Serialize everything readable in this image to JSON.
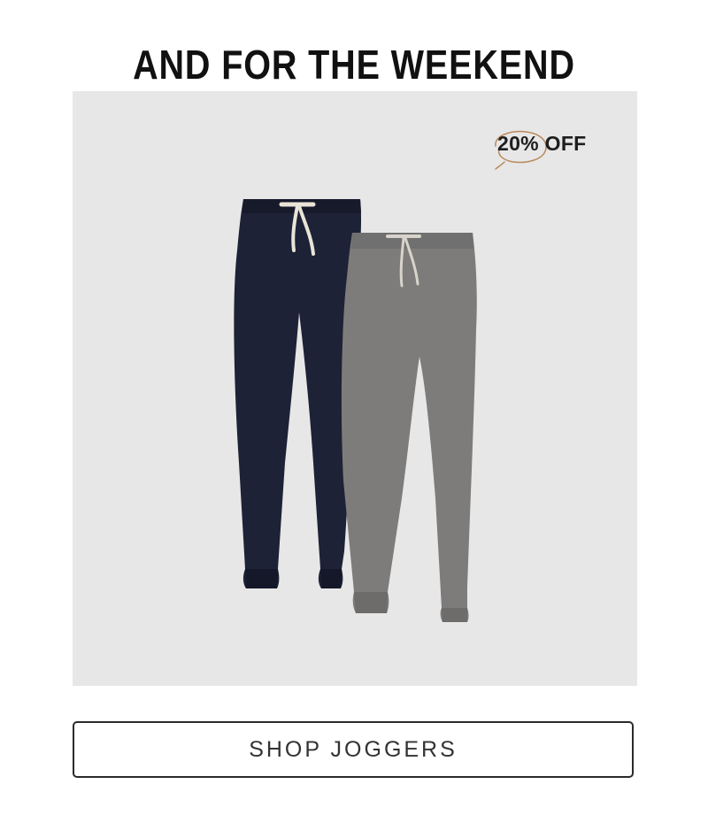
{
  "headline": "AND FOR THE WEEKEND",
  "promo": {
    "badge_text": "20% OFF",
    "background": "#e8e7e7",
    "products": [
      {
        "name": "navy-jogger",
        "color": "#1d2236"
      },
      {
        "name": "grey-jogger",
        "color": "#7e7c7a"
      }
    ]
  },
  "cta": {
    "label": "SHOP JOGGERS"
  },
  "colors": {
    "badge_ring": "#b8895a",
    "text": "#111111",
    "button_border": "#2a2a2a"
  }
}
